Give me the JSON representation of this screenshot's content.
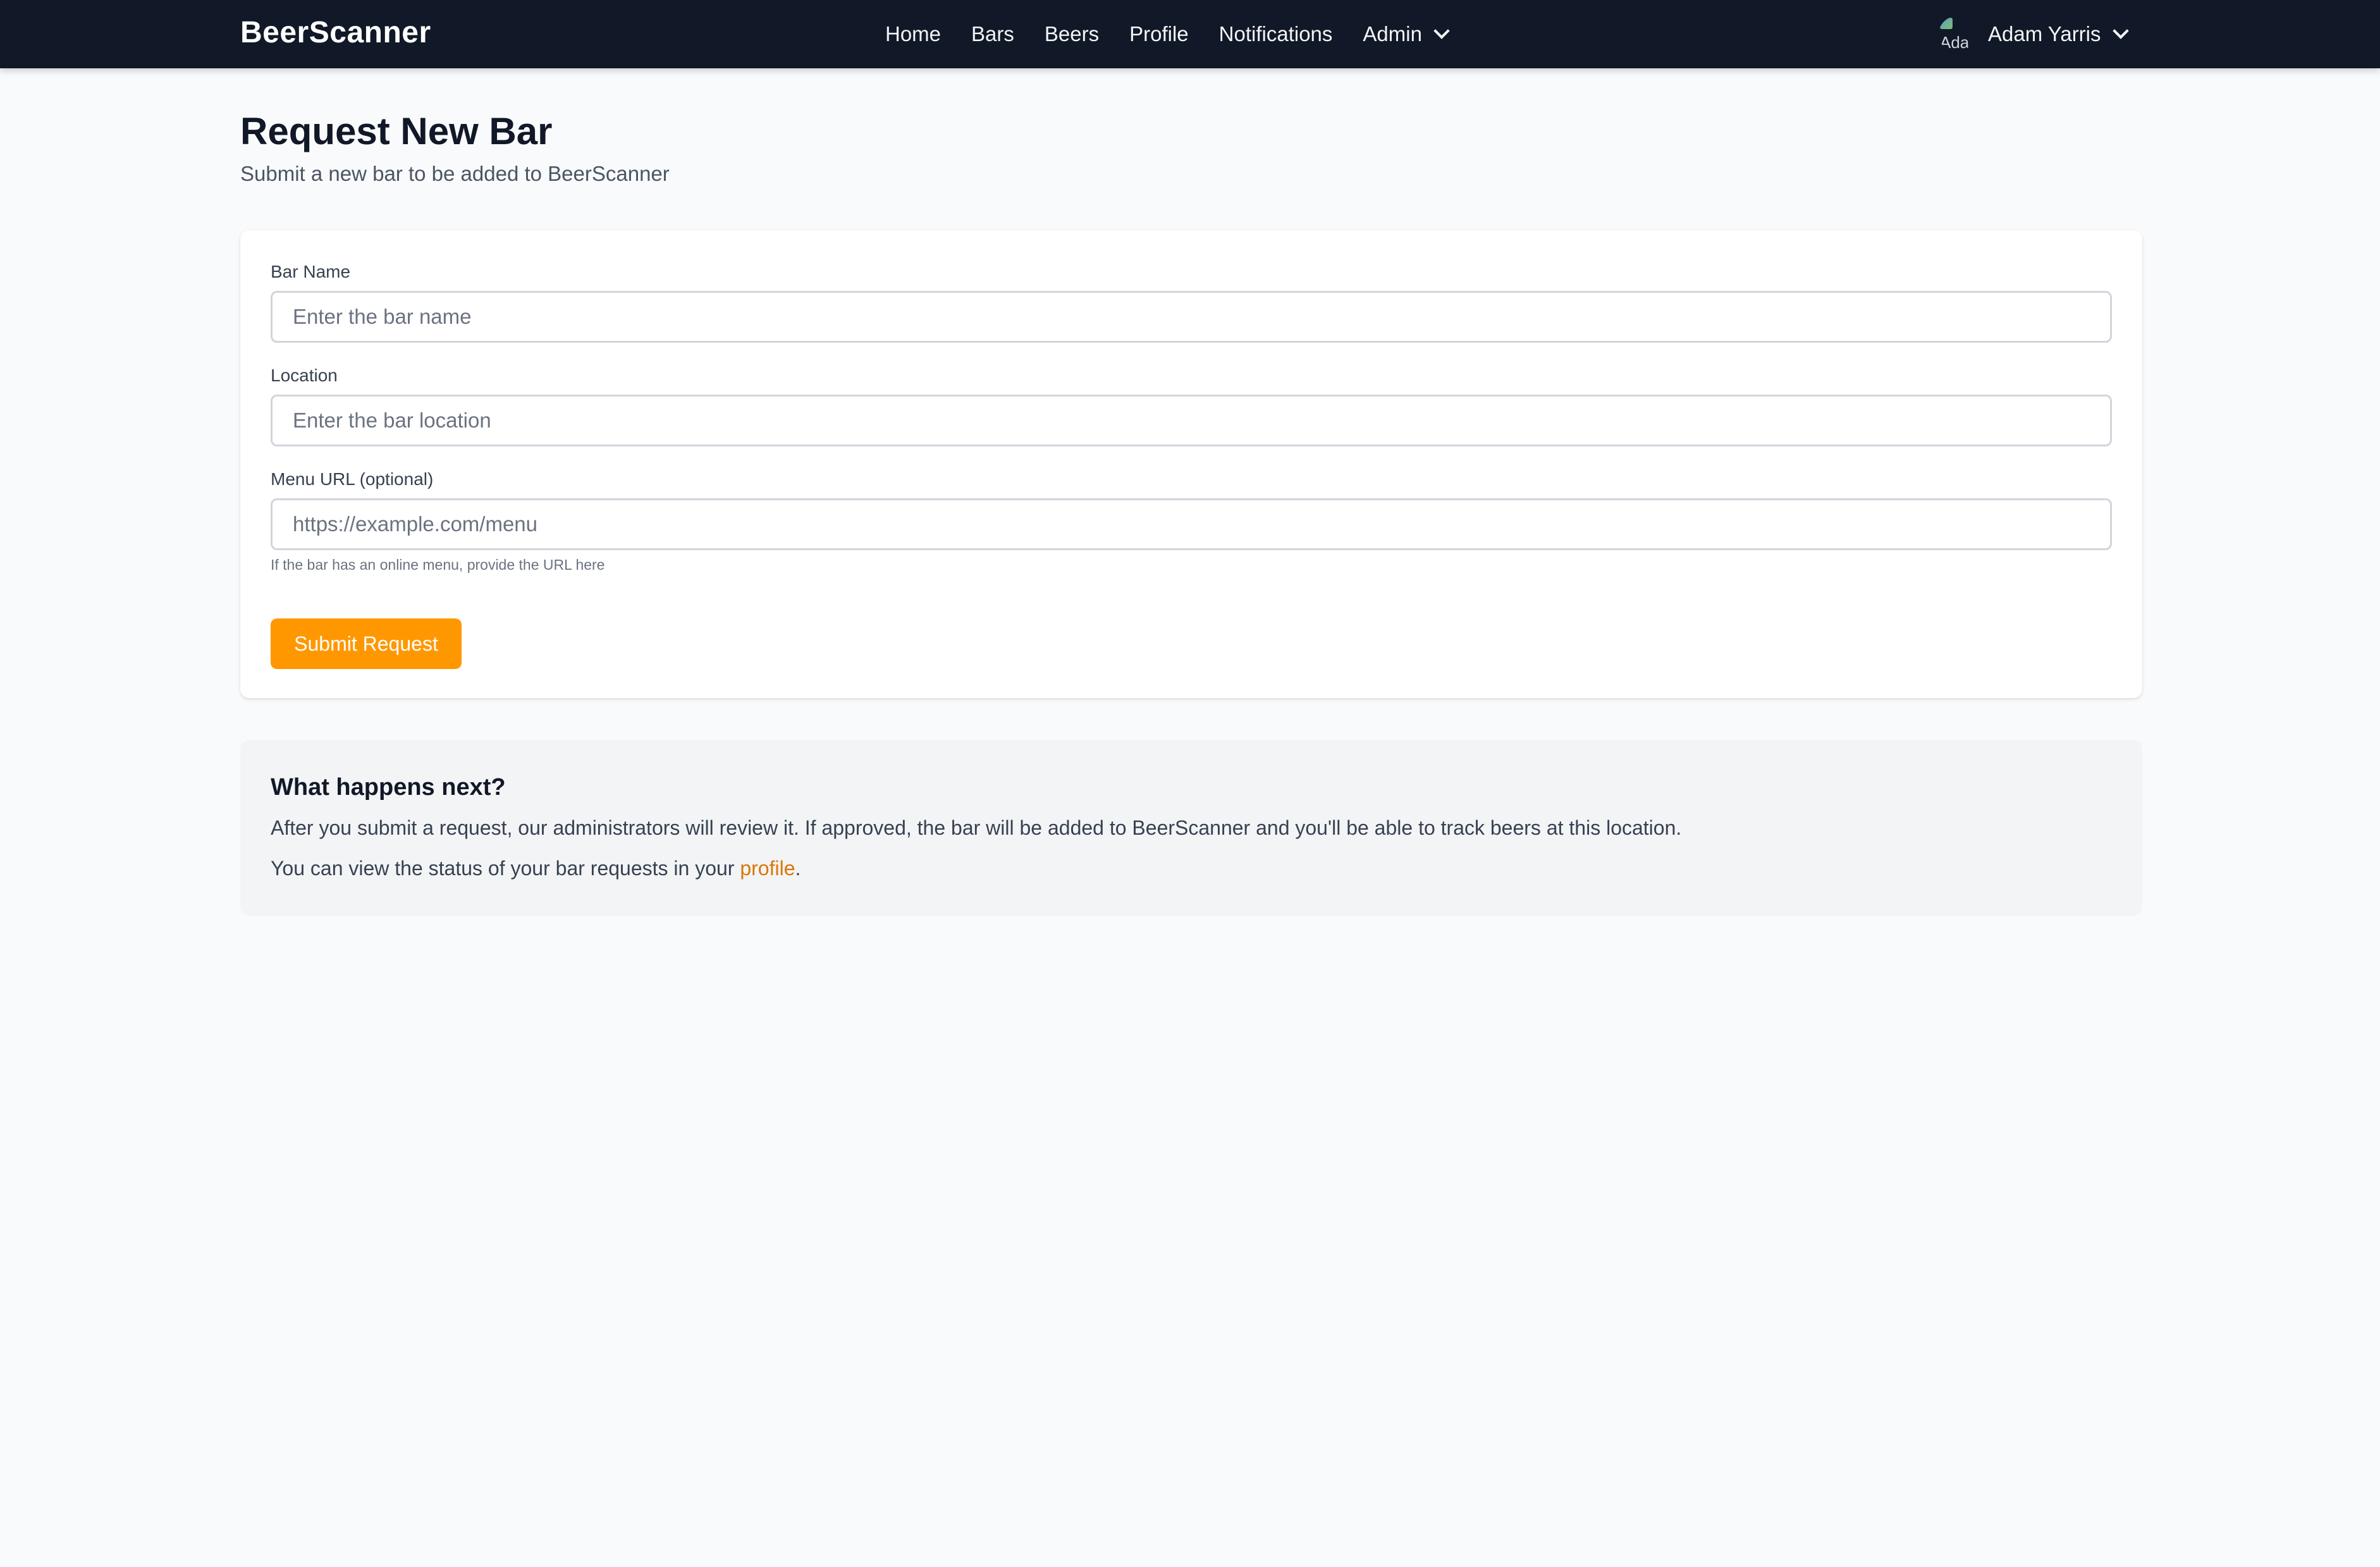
{
  "nav": {
    "brand": "BeerScanner",
    "links": [
      {
        "label": "Home"
      },
      {
        "label": "Bars"
      },
      {
        "label": "Beers"
      },
      {
        "label": "Profile"
      },
      {
        "label": "Notifications"
      },
      {
        "label": "Admin"
      }
    ],
    "user": {
      "avatar_alt": "Ada",
      "name": "Adam Yarris"
    }
  },
  "header": {
    "title": "Request New Bar",
    "subtitle": "Submit a new bar to be added to BeerScanner"
  },
  "form": {
    "bar_name": {
      "label": "Bar Name",
      "value": "",
      "placeholder": "Enter the bar name"
    },
    "location": {
      "label": "Location",
      "value": "",
      "placeholder": "Enter the bar location"
    },
    "menu_url": {
      "label": "Menu URL (optional)",
      "value": "",
      "placeholder": "https://example.com/menu",
      "help": "If the bar has an online menu, provide the URL here"
    },
    "submit_label": "Submit Request"
  },
  "info": {
    "title": "What happens next?",
    "paragraph1": "After you submit a request, our administrators will review it. If approved, the bar will be added to BeerScanner and you'll be able to track beers at this location.",
    "paragraph2_prefix": "You can view the status of your bar requests in your ",
    "paragraph2_link": "profile",
    "paragraph2_suffix": "."
  },
  "colors": {
    "nav_bg": "#111827",
    "accent": "#ff9800",
    "link": "#d97706",
    "page_bg": "#f9fafb",
    "info_bg": "#f3f4f6"
  },
  "icons": {
    "admin_dropdown": "chevron-down-icon",
    "user_dropdown": "chevron-down-icon",
    "avatar": "broken-image-avatar"
  }
}
